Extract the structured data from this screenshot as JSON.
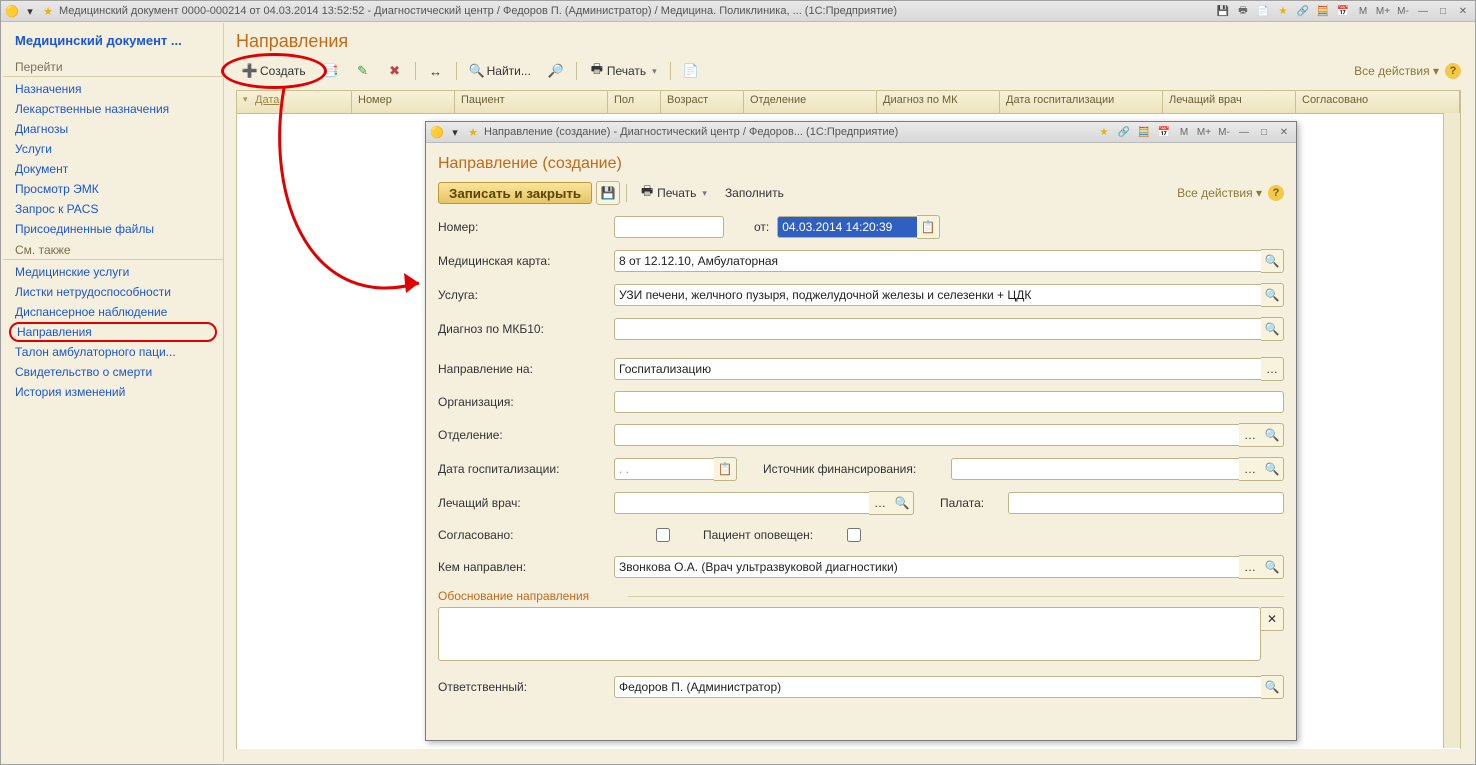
{
  "window": {
    "title": "Медицинский документ 0000-000214 от 04.03.2014 13:52:52 - Диагностический центр / Федоров П. (Администратор) / Медицина. Поликлиника, ...  (1С:Предприятие)"
  },
  "sidebar": {
    "title": "Медицинский документ ...",
    "section1": "Перейти",
    "items1": [
      "Назначения",
      "Лекарственные назначения",
      "Диагнозы",
      "Услуги",
      "Документ",
      "Просмотр ЭМК",
      "Запрос к PACS",
      "Присоединенные файлы"
    ],
    "section2": "См. также",
    "items2": [
      "Медицинские услуги",
      "Листки нетрудоспособности",
      "Диспансерное наблюдение",
      "Направления",
      "Талон амбулаторного паци...",
      "Свидетельство о смерти",
      "История изменений"
    ]
  },
  "page": {
    "title": "Направления",
    "toolbar": {
      "create": "Создать",
      "find": "Найти...",
      "print": "Печать",
      "all_actions": "Все действия"
    },
    "columns": [
      "Дата",
      "Номер",
      "Пациент",
      "Пол",
      "Возраст",
      "Отделение",
      "Диагноз по МК",
      "Дата госпитализации",
      "Лечащий врач",
      "Согласовано"
    ]
  },
  "dialog": {
    "title": "Направление (создание) - Диагностический центр / Федоров...  (1С:Предприятие)",
    "page_title": "Направление (создание)",
    "toolbar": {
      "save_close": "Записать и закрыть",
      "print": "Печать",
      "fill": "Заполнить",
      "all_actions": "Все действия"
    },
    "labels": {
      "number": "Номер:",
      "from": "от:",
      "med_card": "Медицинская карта:",
      "service": "Услуга:",
      "diag": "Диагноз по МКБ10:",
      "ref_to": "Направление на:",
      "org": "Организация:",
      "dept": "Отделение:",
      "hosp_date": "Дата госпитализации:",
      "fin_src": "Источник финансирования:",
      "doctor": "Лечащий врач:",
      "ward": "Палата:",
      "agreed": "Согласовано:",
      "notified": "Пациент оповещен:",
      "referred_by": "Кем направлен:",
      "justification": "Обоснование направления",
      "responsible": "Ответственный:"
    },
    "values": {
      "number": "",
      "date": "04.03.2014 14:20:39",
      "med_card": "8 от 12.12.10, Амбулаторная",
      "service": "УЗИ печени, желчного пузыря, поджелудочной железы и селезенки + ЦДК",
      "diag": "",
      "ref_to": "Госпитализацию",
      "org": "",
      "dept": "",
      "hosp_date": " .  .",
      "fin_src": "",
      "doctor": "",
      "ward": "",
      "referred_by": "Звонкова О.А. (Врач ультразвуковой диагностики)",
      "responsible": "Федоров П. (Администратор)"
    }
  }
}
